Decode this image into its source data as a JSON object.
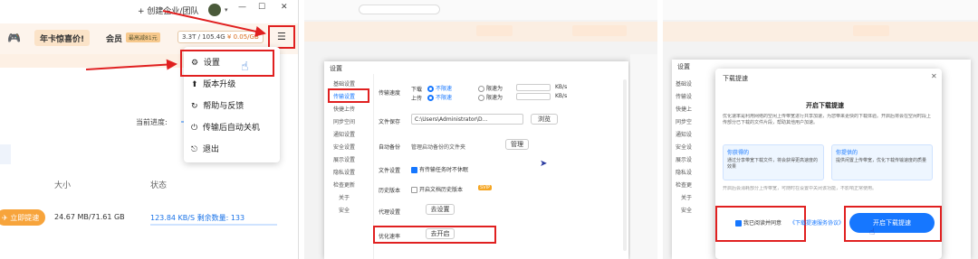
{
  "panel1": {
    "titlebar": {
      "create_org": "创建企业/团队",
      "plus": "+",
      "minimize": "—",
      "maximize": "☐",
      "close": "✕"
    },
    "toolbar": {
      "promo": "年卡惊喜价!",
      "member": "会员",
      "member_sub": "最高减81元",
      "storage": "3.3T / 105.4G",
      "speed": "¥ 0.05/GB"
    },
    "menu": {
      "items": [
        {
          "label": "设置",
          "icon": "gear-icon"
        },
        {
          "label": "版本升级",
          "icon": "upgrade-icon"
        },
        {
          "label": "帮助与反馈",
          "icon": "help-icon"
        },
        {
          "label": "传输后自动关机",
          "icon": "power-icon"
        },
        {
          "label": "退出",
          "icon": "exit-icon"
        }
      ]
    },
    "current_progress": "当前进度:",
    "table": {
      "col_size": "大小",
      "col_status": "状态"
    },
    "row": {
      "boost": "立即提速",
      "size": "24.67 MB/71.61 GB",
      "status": "123.84 KB/S 剩余数量: 133"
    }
  },
  "panel2": {
    "window_title": "设置",
    "sidebar": [
      "基础设置",
      "传输设置",
      "快捷上传",
      "同步空间",
      "通知设置",
      "安全设置",
      "展示设置",
      "隐私设置",
      "检查更新",
      "关于",
      "安全"
    ],
    "speed": {
      "label": "传输速度",
      "download": "下载",
      "upload": "上传",
      "unlimited": "不限速",
      "limited": "限速为",
      "kbs": "KB/s"
    },
    "folder": {
      "label": "文件保存",
      "path": "C:\\Users\\Administrator\\D...",
      "browse": "浏览"
    },
    "autobackup": {
      "label": "自动备份",
      "desc": "管理启动备份的文件夹",
      "manage": "管理"
    },
    "file_settings": {
      "label": "文件设置",
      "option": "有传输任务时不休眠"
    },
    "history": {
      "label": "历史版本",
      "option": "开启文档历史版本",
      "badge": "SVIP"
    },
    "proxy": {
      "label": "代理设置",
      "button": "去设置"
    },
    "optimize": {
      "label": "优化速率",
      "button": "去开启"
    }
  },
  "panel3": {
    "dialog_title": "下载提速",
    "heading": "开启下载提速",
    "desc": "优化速率是利用网络的空闲上传带宽进行共享加速，为您带来更快的下载体验。开启后将会在空闲时段上传部分已下载的文件片段，帮助其他用户加速。",
    "card1": {
      "title": "你获得的",
      "text": "通过分享带宽下载文件，将会获得更高速度的效果"
    },
    "card2": {
      "title": "你提供的",
      "text": "提供闲置上传带宽，优化下载传输速度的质量"
    },
    "fine_print": "开启后会消耗部分上传带宽，可随时在设置中关闭该功能，不影响正常使用。",
    "agree": "我已阅读并同意",
    "agreement_link": "《下载提速服务协议》",
    "confirm": "开启下载提速",
    "sidebar": [
      "基础设",
      "传输设",
      "快捷上",
      "同步空",
      "通知设",
      "安全设",
      "展示设",
      "隐私设",
      "检查更",
      "关于",
      "安全"
    ]
  }
}
